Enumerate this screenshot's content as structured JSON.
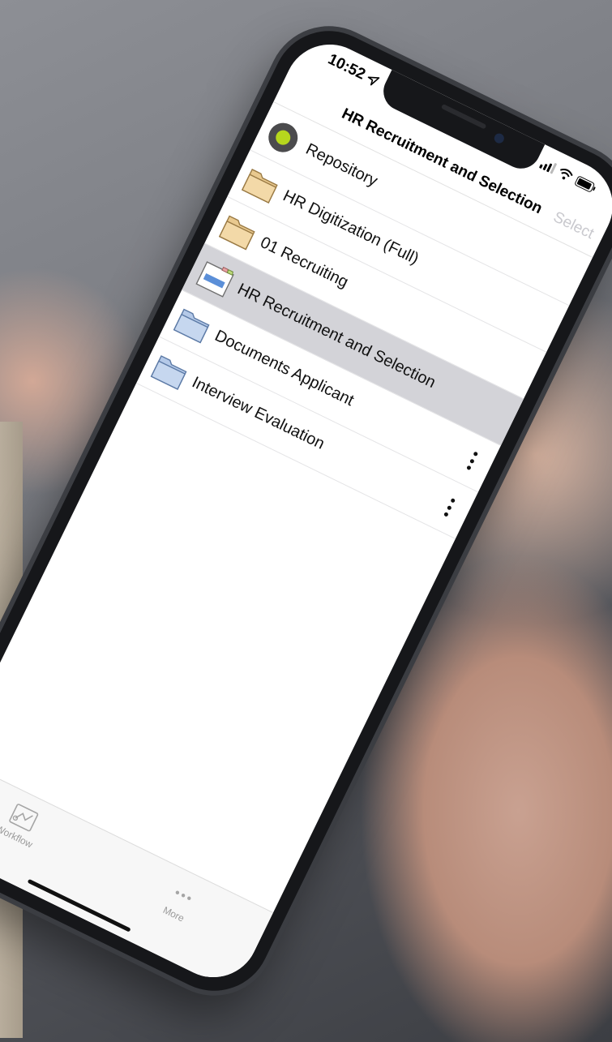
{
  "status_bar": {
    "time": "10:52"
  },
  "nav": {
    "title": "HR Recruitment and Selection",
    "select_label": "Select"
  },
  "list": {
    "items": [
      {
        "label": "Repository",
        "icon": "repository-status-icon",
        "selected": false,
        "has_more": false
      },
      {
        "label": "HR Digitization (Full)",
        "icon": "folder-tan-icon",
        "selected": false,
        "has_more": false
      },
      {
        "label": "01 Recruiting",
        "icon": "folder-tan-icon",
        "selected": false,
        "has_more": false
      },
      {
        "label": "HR Recruitment and Selection",
        "icon": "register-folder-icon",
        "selected": true,
        "has_more": false
      },
      {
        "label": "Documents Applicant",
        "icon": "folder-blue-icon",
        "selected": false,
        "has_more": true
      },
      {
        "label": "Interview Evaluation",
        "icon": "folder-blue-icon",
        "selected": false,
        "has_more": true
      }
    ]
  },
  "tab_bar": {
    "tabs": [
      {
        "label": "Workflow",
        "icon": "workflow-icon"
      },
      {
        "label": "More",
        "icon": "more-dots-icon"
      }
    ]
  },
  "colors": {
    "selected_row": "#d3d3d8",
    "repository_dot": "#b6d71d",
    "folder_tan": "#f3d9a8",
    "folder_blue": "#c6d7ef"
  }
}
